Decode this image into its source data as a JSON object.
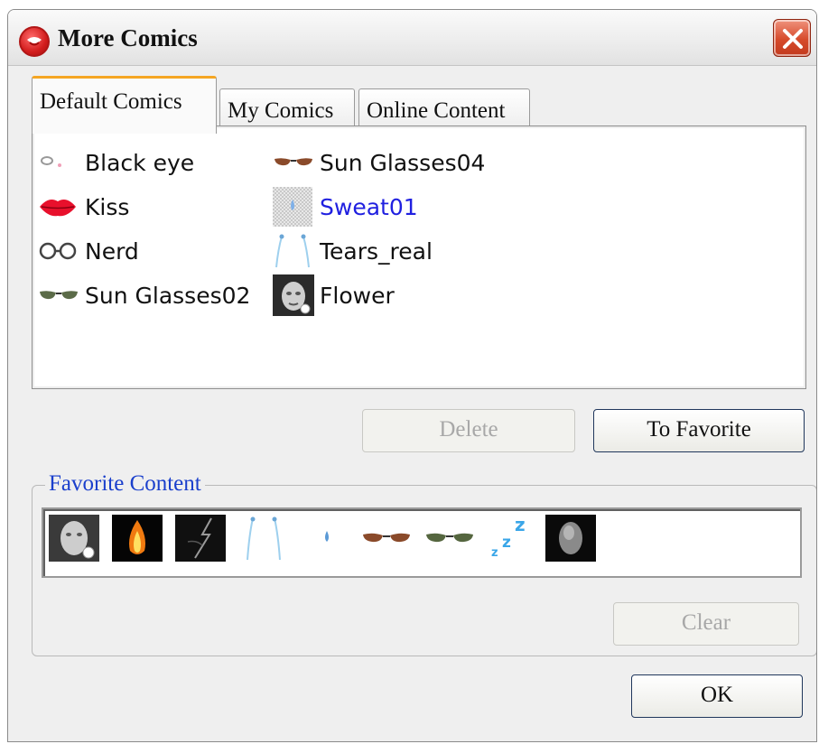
{
  "window": {
    "title": "More Comics",
    "icon": "app-logo-icon",
    "close_icon": "close-icon"
  },
  "tabs": [
    {
      "label": "Default Comics",
      "active": true
    },
    {
      "label": "My Comics",
      "active": false
    },
    {
      "label": "Online Content",
      "active": false
    }
  ],
  "comics": [
    {
      "label": "Black eye",
      "icon": "black-eye-icon",
      "selected": false
    },
    {
      "label": "Kiss",
      "icon": "kiss-lips-icon",
      "selected": false
    },
    {
      "label": "Nerd",
      "icon": "nerd-glasses-icon",
      "selected": false
    },
    {
      "label": "Sun Glasses02",
      "icon": "green-sunglasses-icon",
      "selected": false
    },
    {
      "label": "Sun Glasses04",
      "icon": "brown-sunglasses-icon",
      "selected": false
    },
    {
      "label": "Sweat01",
      "icon": "sweat-drop-icon",
      "selected": true
    },
    {
      "label": "Tears_real",
      "icon": "tears-icon",
      "selected": false
    },
    {
      "label": "Flower",
      "icon": "flower-face-icon",
      "selected": false
    }
  ],
  "buttons": {
    "delete": "Delete",
    "to_favorite": "To Favorite",
    "clear": "Clear",
    "ok": "OK"
  },
  "favorites": {
    "label": "Favorite Content",
    "items": [
      "face-thumbnail-icon",
      "fire-icon",
      "lightning-icon",
      "tears-icon",
      "sweat-drop-icon",
      "brown-sunglasses-icon",
      "green-sunglasses-icon",
      "sleeping-z-icon",
      "smoke-face-icon"
    ]
  },
  "colors": {
    "selected_text": "#2020e0",
    "legend_text": "#1a3fcc",
    "active_tab_accent": "#f5a623"
  }
}
